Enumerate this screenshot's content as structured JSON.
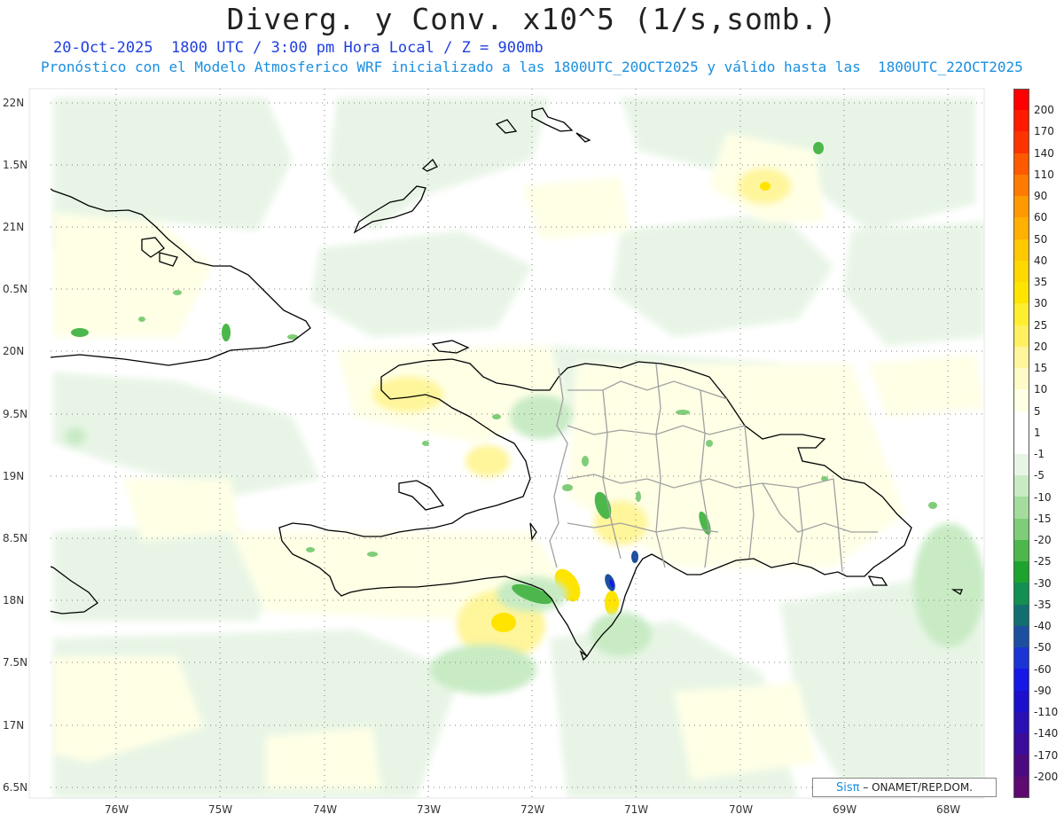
{
  "header": {
    "title": "Diverg. y Conv. x10^5 (1/s,somb.)",
    "subtitle_1": "20-Oct-2025  1800 UTC / 3:00 pm Hora Local / Z = 900mb",
    "subtitle_2": "Pronóstico con el Modelo Atmosferico WRF inicializado a las 1800UTC_20OCT2025 y válido hasta las  1800UTC_22OCT2025"
  },
  "axes": {
    "lat_labels": [
      "22N",
      "1.5N",
      "21N",
      "0.5N",
      "20N",
      "9.5N",
      "19N",
      "8.5N",
      "18N",
      "7.5N",
      "17N",
      "6.5N"
    ],
    "lon_labels": [
      "76W",
      "75W",
      "74W",
      "73W",
      "72W",
      "71W",
      "70W",
      "69W",
      "68W"
    ]
  },
  "colorbar": {
    "labels": [
      "200",
      "170",
      "140",
      "110",
      "90",
      "60",
      "50",
      "40",
      "35",
      "30",
      "25",
      "20",
      "15",
      "10",
      "5",
      "1",
      "-1",
      "-5",
      "-10",
      "-15",
      "-20",
      "-25",
      "-30",
      "-35",
      "-40",
      "-50",
      "-60",
      "-90",
      "-110",
      "-140",
      "-170",
      "-200"
    ],
    "colors": [
      "#ff0000",
      "#ff1a00",
      "#ff3300",
      "#ff5a00",
      "#ff7a00",
      "#ff9900",
      "#ffb000",
      "#ffc800",
      "#ffd800",
      "#ffe400",
      "#ffee30",
      "#fff060",
      "#fff59a",
      "#fffbc8",
      "#ffffe6",
      "#ffffff",
      "#ffffff",
      "#e8f5e6",
      "#c8ebc4",
      "#a4dc9e",
      "#7fcd78",
      "#4cb84c",
      "#1fa32f",
      "#138f52",
      "#136f6f",
      "#1c4f9f",
      "#1b34d6",
      "#1717e6",
      "#1c10cc",
      "#2a0fb3",
      "#3b0c99",
      "#4d0a80",
      "#5e0a70"
    ]
  },
  "credit": {
    "brand": "Sisπ",
    "text": " – ONAMET/REP.DOM."
  }
}
